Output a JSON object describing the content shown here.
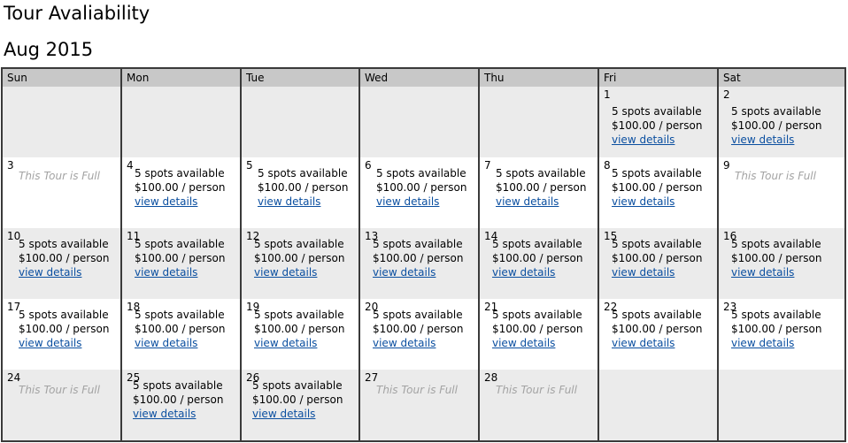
{
  "title": "Tour Avaliability",
  "month": "Aug 2015",
  "weekdays": [
    "Sun",
    "Mon",
    "Tue",
    "Wed",
    "Thu",
    "Fri",
    "Sat"
  ],
  "spots_text": "5 spots available",
  "price_text": "$100.00 / person",
  "link_text": "view details",
  "full_text": "This Tour is Full",
  "colors": {
    "link": "#0b4fa0",
    "header_bg": "#c8c8c8",
    "band_bg": "#ebebeb",
    "full_text": "#a3a3a3"
  },
  "weeks": [
    [
      null,
      null,
      null,
      null,
      null,
      {
        "day": "1",
        "status": "available"
      },
      {
        "day": "2",
        "status": "available"
      }
    ],
    [
      {
        "day": "3",
        "status": "full"
      },
      {
        "day": "4",
        "status": "available"
      },
      {
        "day": "5",
        "status": "available"
      },
      {
        "day": "6",
        "status": "available"
      },
      {
        "day": "7",
        "status": "available"
      },
      {
        "day": "8",
        "status": "available"
      },
      {
        "day": "9",
        "status": "full"
      }
    ],
    [
      {
        "day": "10",
        "status": "available"
      },
      {
        "day": "11",
        "status": "available"
      },
      {
        "day": "12",
        "status": "available"
      },
      {
        "day": "13",
        "status": "available"
      },
      {
        "day": "14",
        "status": "available"
      },
      {
        "day": "15",
        "status": "available"
      },
      {
        "day": "16",
        "status": "available"
      }
    ],
    [
      {
        "day": "17",
        "status": "available"
      },
      {
        "day": "18",
        "status": "available"
      },
      {
        "day": "19",
        "status": "available"
      },
      {
        "day": "20",
        "status": "available"
      },
      {
        "day": "21",
        "status": "available"
      },
      {
        "day": "22",
        "status": "available"
      },
      {
        "day": "23",
        "status": "available"
      }
    ],
    [
      {
        "day": "24",
        "status": "full"
      },
      {
        "day": "25",
        "status": "available"
      },
      {
        "day": "26",
        "status": "available"
      },
      {
        "day": "27",
        "status": "full"
      },
      {
        "day": "28",
        "status": "full"
      },
      null,
      null
    ]
  ]
}
